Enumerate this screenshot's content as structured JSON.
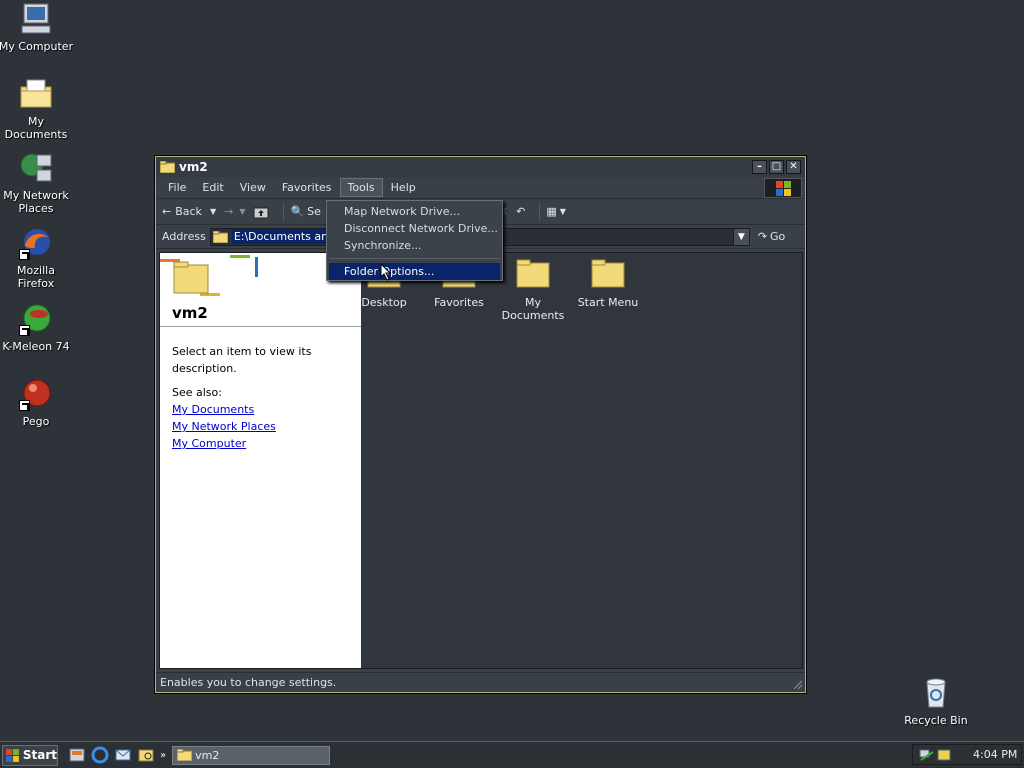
{
  "desktop": {
    "icons": [
      {
        "label": "My Computer"
      },
      {
        "label": "My Documents"
      },
      {
        "label": "My Network Places"
      },
      {
        "label": "Mozilla Firefox"
      },
      {
        "label": "K-Meleon 74"
      },
      {
        "label": "Pego"
      },
      {
        "label": "Recycle Bin"
      }
    ]
  },
  "window": {
    "title": "vm2",
    "menu": [
      "File",
      "Edit",
      "View",
      "Favorites",
      "Tools",
      "Help"
    ],
    "toolbar": {
      "back_label": "Back",
      "search_label": "Se"
    },
    "address": {
      "label": "Address",
      "value": "E:\\Documents and S",
      "go_label": "Go"
    },
    "left_pane": {
      "folder_name": "vm2",
      "description": "Select an item to view its description.",
      "see_also": "See also:",
      "links": [
        "My Documents",
        "My Network Places",
        "My Computer"
      ]
    },
    "files": [
      {
        "label": "Desktop"
      },
      {
        "label": "Favorites"
      },
      {
        "label": "My Documents"
      },
      {
        "label": "Start Menu"
      }
    ],
    "status": "Enables you to change settings."
  },
  "tools_menu": {
    "items": [
      "Map Network Drive...",
      "Disconnect Network Drive...",
      "Synchronize...",
      "Folder Options..."
    ]
  },
  "taskbar": {
    "start_label": "Start",
    "task_label": "vm2",
    "clock": "4:04 PM"
  },
  "colors": {
    "desktop_bg": "#2e3339",
    "highlight": "#0a246a",
    "link": "#0000cc",
    "folder": "#f2d97a"
  }
}
